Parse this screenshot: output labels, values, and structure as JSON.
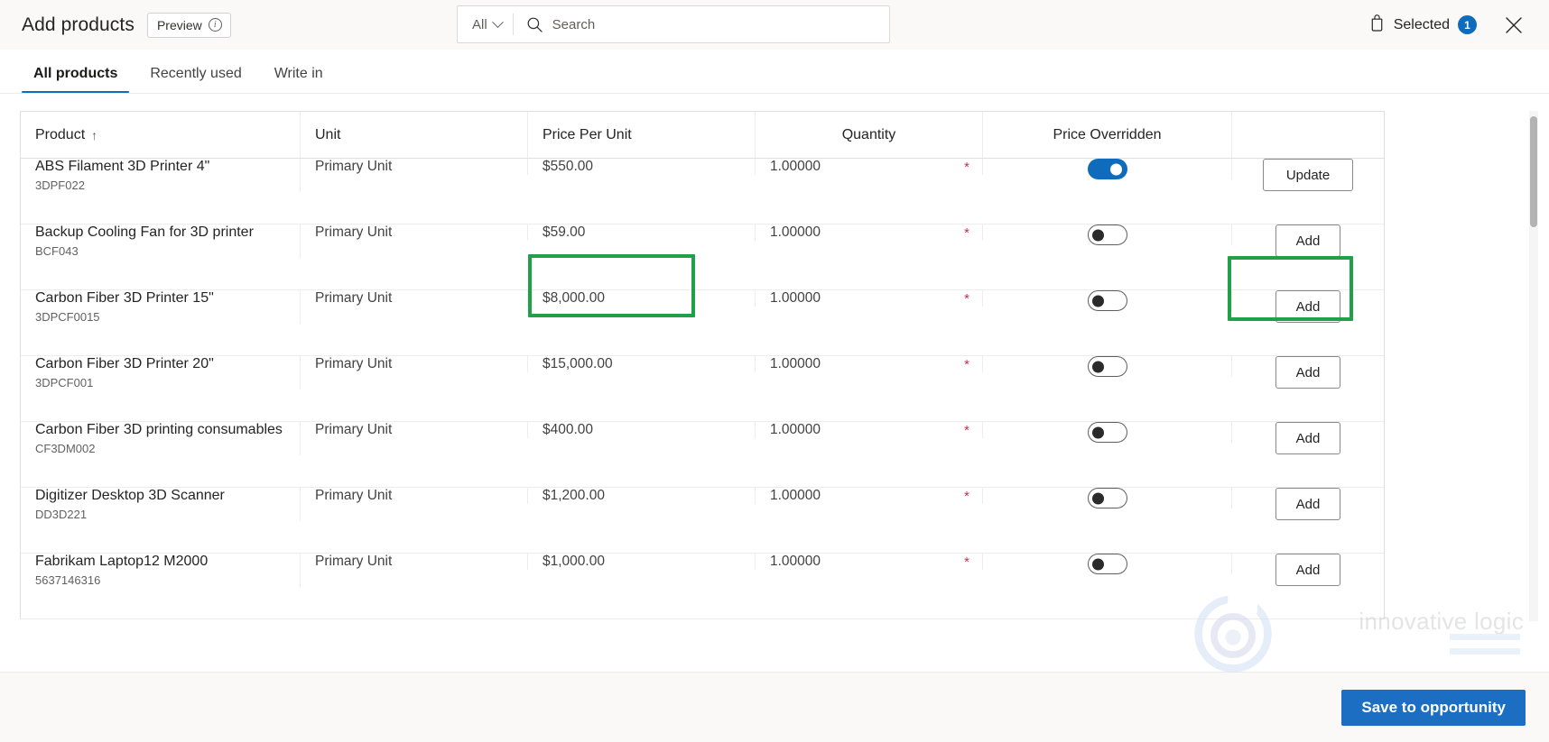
{
  "header": {
    "title": "Add products",
    "preview_label": "Preview",
    "info_icon": "info-icon",
    "selected_label": "Selected",
    "selected_count": "1",
    "bag_icon": "shopping-bag-icon",
    "close_icon": "close-icon"
  },
  "search": {
    "scope": "All",
    "placeholder": "Search",
    "value": "",
    "icon": "search-icon",
    "chevron": "chevron-down-icon"
  },
  "tabs": [
    {
      "label": "All products",
      "active": true
    },
    {
      "label": "Recently used",
      "active": false
    },
    {
      "label": "Write in",
      "active": false
    }
  ],
  "table": {
    "columns": [
      {
        "label": "Product",
        "sort": "↑"
      },
      {
        "label": "Unit",
        "sort": ""
      },
      {
        "label": "Price Per Unit",
        "sort": ""
      },
      {
        "label": "Quantity",
        "sort": ""
      },
      {
        "label": "Price Overridden",
        "sort": ""
      },
      {
        "label": "",
        "sort": ""
      }
    ],
    "rows": [
      {
        "product": "ABS Filament 3D Printer 4\"",
        "code": "3DPF022",
        "unit": "Primary Unit",
        "price": "$550.00",
        "quantity": "1.00000",
        "required": "*",
        "overridden": true,
        "action": "Update"
      },
      {
        "product": "Backup Cooling Fan for 3D printer",
        "code": "BCF043",
        "unit": "Primary Unit",
        "price": "$59.00",
        "quantity": "1.00000",
        "required": "*",
        "overridden": false,
        "action": "Add"
      },
      {
        "product": "Carbon Fiber 3D Printer 15\"",
        "code": "3DPCF0015",
        "unit": "Primary Unit",
        "price": "$8,000.00",
        "quantity": "1.00000",
        "required": "*",
        "overridden": false,
        "action": "Add"
      },
      {
        "product": "Carbon Fiber 3D Printer 20\"",
        "code": "3DPCF001",
        "unit": "Primary Unit",
        "price": "$15,000.00",
        "quantity": "1.00000",
        "required": "*",
        "overridden": false,
        "action": "Add"
      },
      {
        "product": "Carbon Fiber 3D printing consumables",
        "code": "CF3DM002",
        "unit": "Primary Unit",
        "price": "$400.00",
        "quantity": "1.00000",
        "required": "*",
        "overridden": false,
        "action": "Add"
      },
      {
        "product": "Digitizer Desktop 3D Scanner",
        "code": "DD3D221",
        "unit": "Primary Unit",
        "price": "$1,200.00",
        "quantity": "1.00000",
        "required": "*",
        "overridden": false,
        "action": "Add"
      },
      {
        "product": "Fabrikam Laptop12 M2000",
        "code": "5637146316",
        "unit": "Primary Unit",
        "price": "$1,000.00",
        "quantity": "1.00000",
        "required": "*",
        "overridden": false,
        "action": "Add"
      }
    ]
  },
  "footer": {
    "save_label": "Save to opportunity"
  },
  "watermark": {
    "text": "innovative logic"
  },
  "colors": {
    "accent": "#0f6cbd",
    "primary_button": "#1b6ec2",
    "highlight": "#21a04a",
    "required": "#c4314b",
    "header_bg": "#faf9f8"
  }
}
